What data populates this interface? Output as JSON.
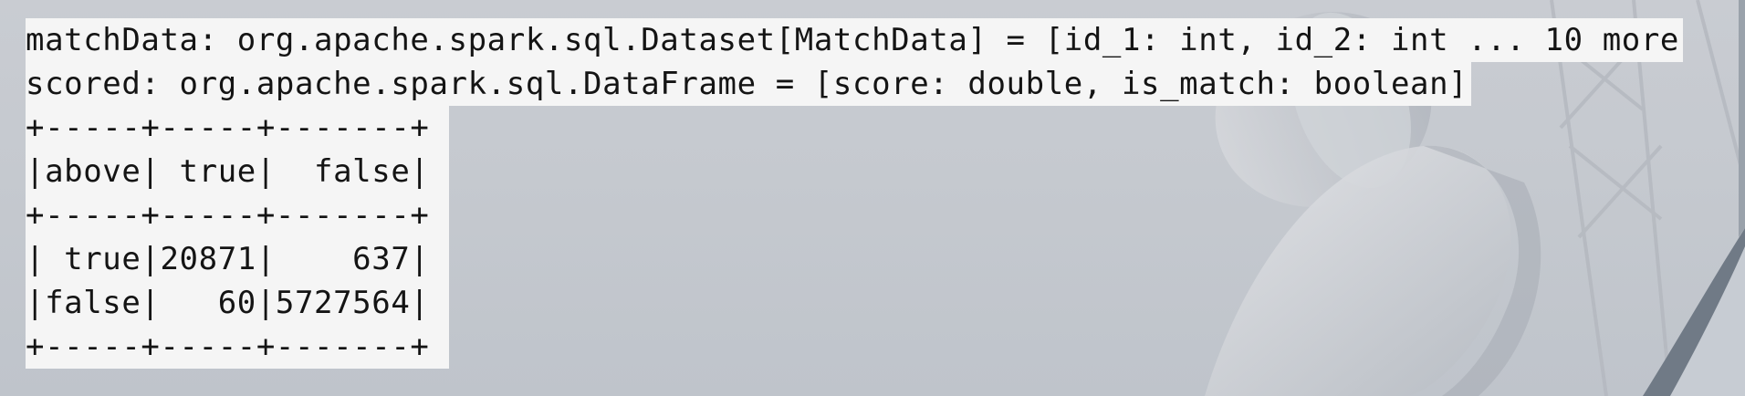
{
  "terminal": {
    "output_lines": [
      "matchData: org.apache.spark.sql.Dataset[MatchData] = [id_1: int, id_2: int ... 10 more",
      "scored: org.apache.spark.sql.DataFrame = [score: double, is_match: boolean]"
    ],
    "table_lines": [
      "+-----+-----+-------+",
      "|above| true|  false|",
      "+-----+-----+-------+",
      "| true|20871|    637|",
      "|false|   60|5727564|",
      "+-----+-----+-------+"
    ]
  }
}
